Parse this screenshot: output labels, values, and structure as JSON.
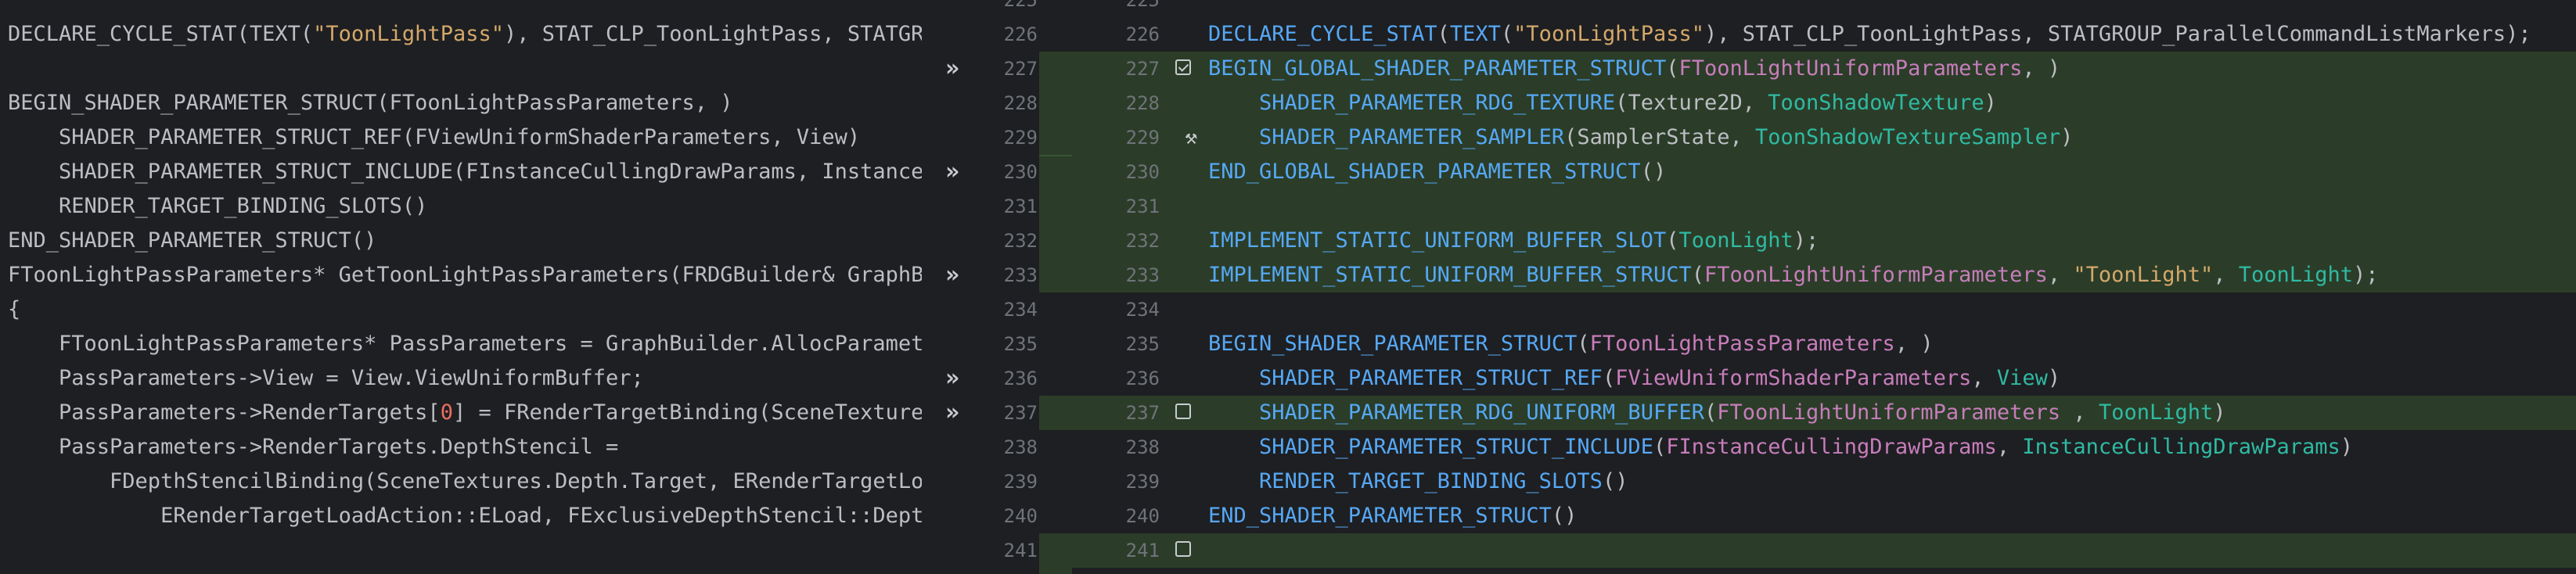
{
  "left": {
    "lines": [
      "",
      "DECLARE_CYCLE_STAT(TEXT(\"ToonLightPass\"), STAT_CLP_ToonLightPass, STATGRO",
      "",
      "BEGIN_SHADER_PARAMETER_STRUCT(FToonLightPassParameters, )",
      "    SHADER_PARAMETER_STRUCT_REF(FViewUniformShaderParameters, View)",
      "    SHADER_PARAMETER_STRUCT_INCLUDE(FInstanceCullingDrawParams, InstanceC",
      "    RENDER_TARGET_BINDING_SLOTS()",
      "END_SHADER_PARAMETER_STRUCT()",
      "FToonLightPassParameters* GetToonLightPassParameters(FRDGBuilder& GraphBu",
      "{",
      "    FToonLightPassParameters* PassParameters = GraphBuilder.AllocParamete",
      "    PassParameters->View = View.ViewUniformBuffer;",
      "    PassParameters->RenderTargets[0] = FRenderTargetBinding(SceneTextures",
      "    PassParameters->RenderTargets.DepthStencil =",
      "        FDepthStencilBinding(SceneTextures.Depth.Target, ERenderTargetLoa",
      "            ERenderTargetLoadAction::ELoad, FExclusiveDepthStencil::Depth",
      ""
    ]
  },
  "left_gutter": {
    "numbers": [
      "225",
      "226",
      "227",
      "228",
      "229",
      "230",
      "231",
      "232",
      "233",
      "234",
      "235",
      "236",
      "237",
      "238",
      "239",
      "240",
      "241"
    ],
    "arrow_glyph": "»"
  },
  "right_gutter": {
    "numbers": [
      "225",
      "226",
      "227",
      "228",
      "229",
      "230",
      "231",
      "232",
      "233",
      "234",
      "235",
      "236",
      "237",
      "238",
      "239",
      "240",
      "241"
    ],
    "icons": {
      "checked": "checkbox-checked-icon",
      "unchecked": "checkbox-icon",
      "hammer": "hammer-icon"
    },
    "hammer_glyph": "⚒"
  },
  "right": {
    "lines": [
      "",
      "DECLARE_CYCLE_STAT(TEXT(\"ToonLightPass\"), STAT_CLP_ToonLightPass, STATGROUP_ParallelCommandListMarkers);",
      "BEGIN_GLOBAL_SHADER_PARAMETER_STRUCT(FToonLightUniformParameters, )",
      "    SHADER_PARAMETER_RDG_TEXTURE(Texture2D, ToonShadowTexture)",
      "    SHADER_PARAMETER_SAMPLER(SamplerState, ToonShadowTextureSampler)",
      "END_GLOBAL_SHADER_PARAMETER_STRUCT()",
      "",
      "IMPLEMENT_STATIC_UNIFORM_BUFFER_SLOT(ToonLight);",
      "IMPLEMENT_STATIC_UNIFORM_BUFFER_STRUCT(FToonLightUniformParameters, \"ToonLight\", ToonLight);",
      "",
      "BEGIN_SHADER_PARAMETER_STRUCT(FToonLightPassParameters, )",
      "    SHADER_PARAMETER_STRUCT_REF(FViewUniformShaderParameters, View)",
      "    SHADER_PARAMETER_RDG_UNIFORM_BUFFER(FToonLightUniformParameters , ToonLight)",
      "    SHADER_PARAMETER_STRUCT_INCLUDE(FInstanceCullingDrawParams, InstanceCullingDrawParams)",
      "    RENDER_TARGET_BINDING_SLOTS()",
      "END_SHADER_PARAMETER_STRUCT()",
      ""
    ]
  },
  "colors": {
    "background": "#1e1f22",
    "changed_bg": "#2b3d28",
    "function": "#56a8f5",
    "string": "#6aab73",
    "type": "#c77dbb",
    "teal": "#2fbaa3",
    "line_number": "#6f737a"
  }
}
